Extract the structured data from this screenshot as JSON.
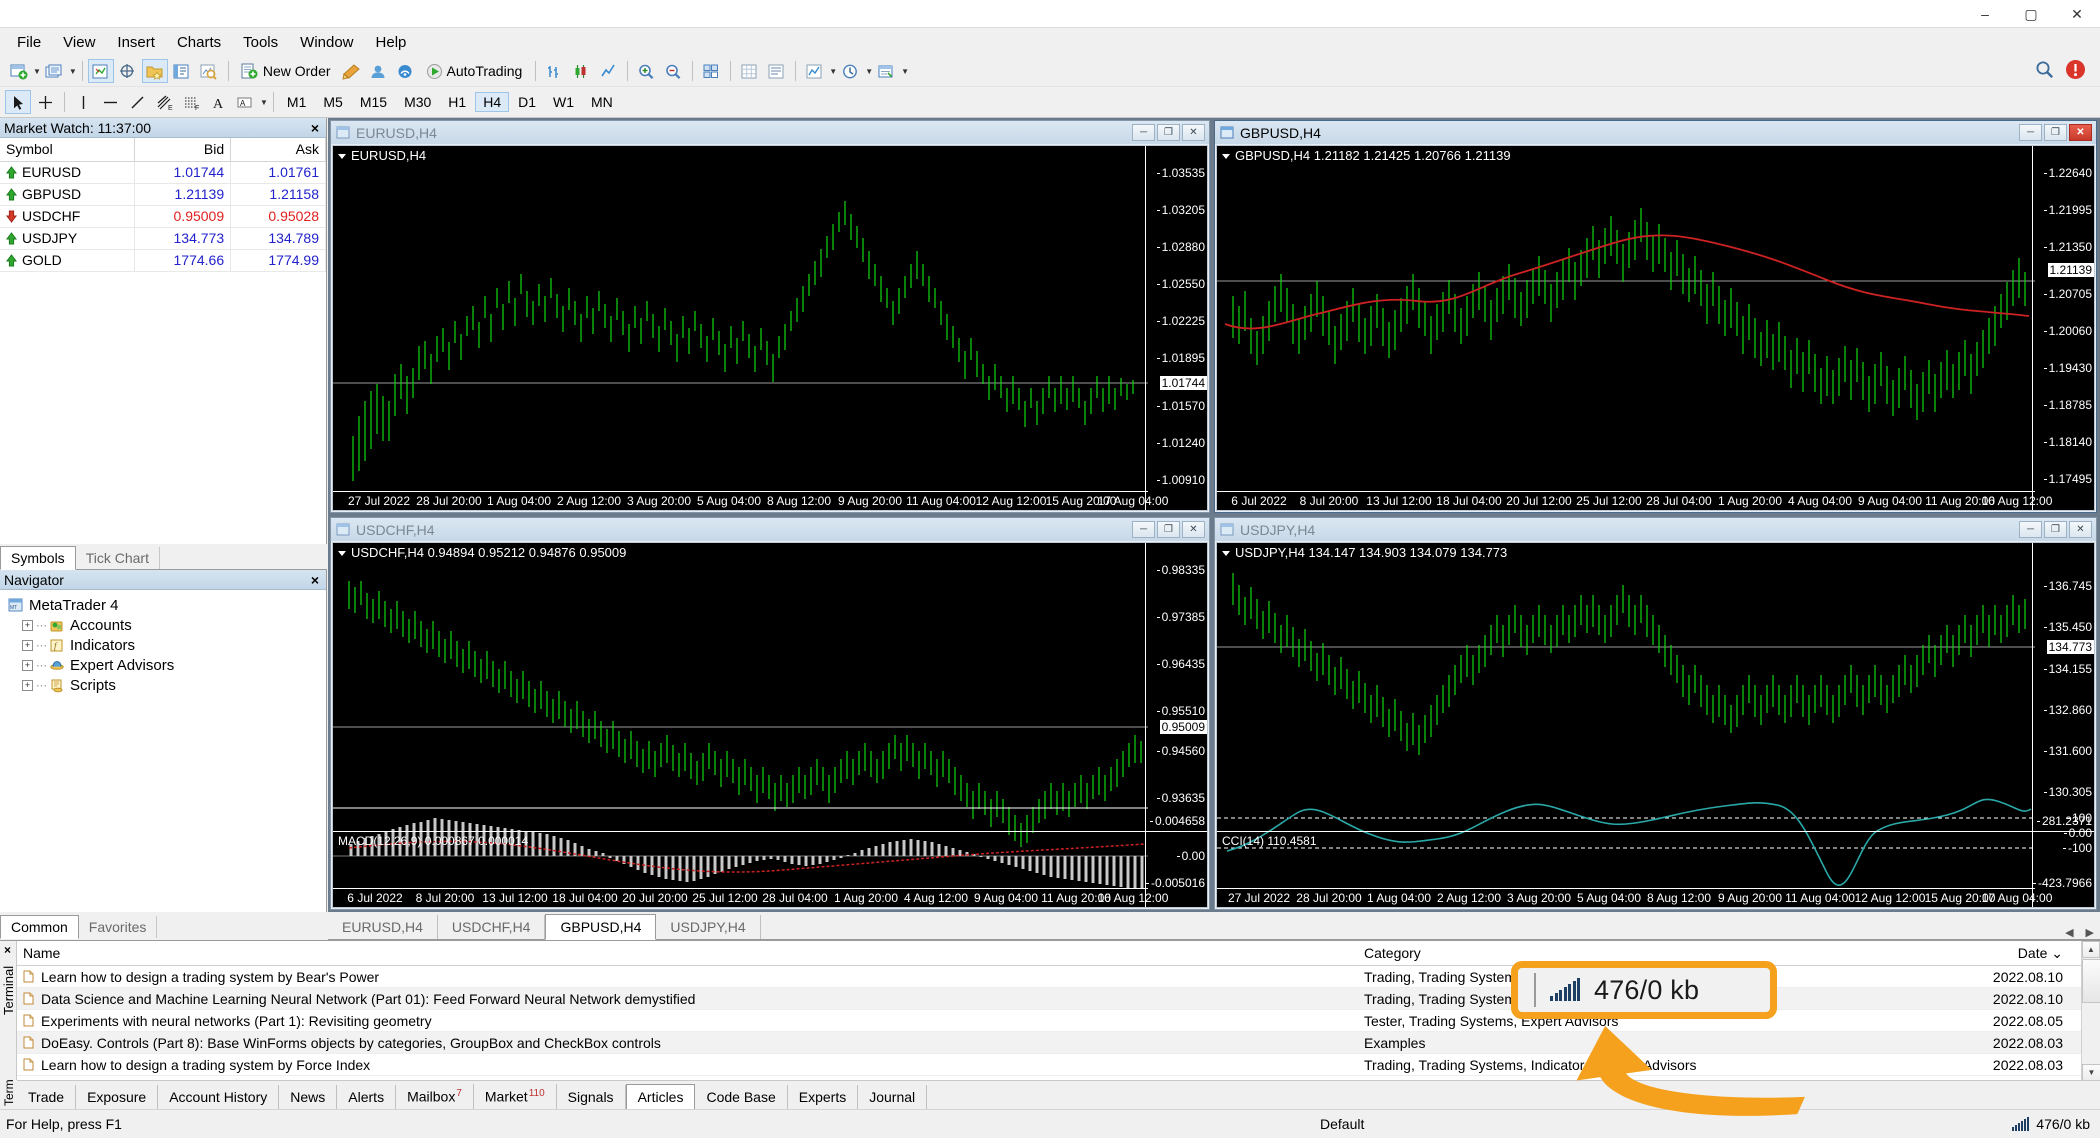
{
  "window": {
    "minimize": "–",
    "maximize": "▢",
    "close": "✕"
  },
  "menu": [
    "File",
    "View",
    "Insert",
    "Charts",
    "Tools",
    "Window",
    "Help"
  ],
  "toolbar": {
    "new_order_label": "New Order",
    "autotrading_label": "AutoTrading",
    "timeframes": [
      "M1",
      "M5",
      "M15",
      "M30",
      "H1",
      "H4",
      "D1",
      "W1",
      "MN"
    ],
    "timeframe_selected": "H4"
  },
  "market_watch": {
    "title": "Market Watch: 11:37:00",
    "close": "×",
    "columns": [
      "Symbol",
      "Bid",
      "Ask"
    ],
    "rows": [
      {
        "symbol": "EURUSD",
        "bid": "1.01744",
        "ask": "1.01761",
        "dir": "up"
      },
      {
        "symbol": "GBPUSD",
        "bid": "1.21139",
        "ask": "1.21158",
        "dir": "up"
      },
      {
        "symbol": "USDCHF",
        "bid": "0.95009",
        "ask": "0.95028",
        "dir": "down"
      },
      {
        "symbol": "USDJPY",
        "bid": "134.773",
        "ask": "134.789",
        "dir": "up"
      },
      {
        "symbol": "GOLD",
        "bid": "1774.66",
        "ask": "1774.99",
        "dir": "up"
      }
    ],
    "tabs": [
      "Symbols",
      "Tick Chart"
    ],
    "tab_selected": "Symbols"
  },
  "navigator": {
    "title": "Navigator",
    "close": "×",
    "root": "MetaTrader 4",
    "items": [
      "Accounts",
      "Indicators",
      "Expert Advisors",
      "Scripts"
    ],
    "tabs": [
      "Common",
      "Favorites"
    ],
    "tab_selected": "Common"
  },
  "charts": [
    {
      "title": "EURUSD,H4",
      "label": "EURUSD,H4",
      "active": false,
      "price_ticks": [
        "1.03535",
        "1.03205",
        "1.02880",
        "1.02550",
        "1.02225",
        "1.01895",
        "1.01570",
        "1.01240",
        "1.00910"
      ],
      "current_price": "1.01744",
      "time_ticks": [
        "27 Jul 2022",
        "28 Jul 20:00",
        "1 Aug 04:00",
        "2 Aug 12:00",
        "3 Aug 20:00",
        "5 Aug 04:00",
        "8 Aug 12:00",
        "9 Aug 20:00",
        "11 Aug 04:00",
        "12 Aug 12:00",
        "15 Aug 20:00",
        "17 Aug 04:00"
      ]
    },
    {
      "title": "GBPUSD,H4",
      "label": "GBPUSD,H4  1.21182 1.21425 1.20766 1.21139",
      "active": true,
      "price_ticks": [
        "1.22640",
        "1.21995",
        "1.21350",
        "1.20705",
        "1.20060",
        "1.19430",
        "1.18785",
        "1.18140",
        "1.17495"
      ],
      "current_price": "1.21139",
      "time_ticks": [
        "6 Jul 2022",
        "8 Jul 20:00",
        "13 Jul 12:00",
        "18 Jul 04:00",
        "20 Jul 12:00",
        "25 Jul 12:00",
        "28 Jul 04:00",
        "1 Aug 20:00",
        "4 Aug 04:00",
        "9 Aug 04:00",
        "11 Aug 20:00",
        "16 Aug 12:00"
      ]
    },
    {
      "title": "USDCHF,H4",
      "label": "USDCHF,H4  0.94894 0.95212 0.94876 0.95009",
      "active": false,
      "price_ticks": [
        "0.98335",
        "0.97385",
        "0.96435",
        "0.95510",
        "0.94560",
        "0.93635"
      ],
      "current_price": "0.95009",
      "indicator": {
        "name": "MACD(12,26,9) 0.000867 0.000014",
        "ticks": [
          "0.004658",
          "0.00",
          "-0.005016"
        ]
      },
      "time_ticks": [
        "6 Jul 2022",
        "8 Jul 20:00",
        "13 Jul 12:00",
        "18 Jul 04:00",
        "20 Jul 20:00",
        "25 Jul 12:00",
        "28 Jul 04:00",
        "1 Aug 20:00",
        "4 Aug 12:00",
        "9 Aug 04:00",
        "11 Aug 20:00",
        "16 Aug 12:00"
      ]
    },
    {
      "title": "USDJPY,H4",
      "label": "USDJPY,H4  134.147 134.903 134.079 134.773",
      "active": false,
      "price_ticks": [
        "136.745",
        "135.450",
        "134.155",
        "132.860",
        "131.600",
        "130.305"
      ],
      "current_price": "134.773",
      "indicator": {
        "name": "CCI(14) 110.4581",
        "ticks": [
          "281.2371",
          "100",
          "0.00",
          "-100",
          "-423.7966"
        ]
      },
      "time_ticks": [
        "27 Jul 2022",
        "28 Jul 20:00",
        "1 Aug 04:00",
        "2 Aug 12:00",
        "3 Aug 20:00",
        "5 Aug 04:00",
        "8 Aug 12:00",
        "9 Aug 20:00",
        "11 Aug 04:00",
        "12 Aug 12:00",
        "15 Aug 20:00",
        "17 Aug 04:00"
      ]
    }
  ],
  "chart_tabs": {
    "items": [
      "EURUSD,H4",
      "USDCHF,H4",
      "GBPUSD,H4",
      "USDJPY,H4"
    ],
    "selected": "GBPUSD,H4"
  },
  "terminal": {
    "vertical_label": "Terminal",
    "close": "×",
    "columns": [
      "Name",
      "Category",
      "Date"
    ],
    "sort_glyph": "⌄",
    "rows": [
      {
        "name": "Learn how to design a trading system by Bear's Power",
        "category": "Trading, Trading Systems,",
        "date": "2022.08.10"
      },
      {
        "name": "Data Science and Machine Learning  Neural Network (Part 01): Feed Forward Neural Network demystified",
        "category": "Trading, Trading Systems,",
        "date": "2022.08.10"
      },
      {
        "name": "Experiments with neural networks (Part 1): Revisiting geometry",
        "category": "Tester, Trading Systems, Expert Advisors",
        "date": "2022.08.05"
      },
      {
        "name": "DoEasy. Controls (Part 8): Base WinForms objects by categories, GroupBox and CheckBox controls",
        "category": "Examples",
        "date": "2022.08.03"
      },
      {
        "name": "Learn how to design a trading system by Force Index",
        "category": "Trading, Trading Systems, Indicators, Expert Advisors",
        "date": "2022.08.03"
      }
    ]
  },
  "bottom_tabs": {
    "vertical_label": "Term",
    "items": [
      {
        "label": "Trade",
        "badge": ""
      },
      {
        "label": "Exposure",
        "badge": ""
      },
      {
        "label": "Account History",
        "badge": ""
      },
      {
        "label": "News",
        "badge": ""
      },
      {
        "label": "Alerts",
        "badge": ""
      },
      {
        "label": "Mailbox",
        "badge": "7"
      },
      {
        "label": "Market",
        "badge": "110"
      },
      {
        "label": "Signals",
        "badge": ""
      },
      {
        "label": "Articles",
        "badge": ""
      },
      {
        "label": "Code Base",
        "badge": ""
      },
      {
        "label": "Experts",
        "badge": ""
      },
      {
        "label": "Journal",
        "badge": ""
      }
    ],
    "selected": "Articles"
  },
  "status_bar": {
    "help": "For Help, press F1",
    "profile": "Default",
    "connection": "476/0 kb"
  },
  "callout": {
    "value": "476/0 kb"
  },
  "colors": {
    "accent_orange": "#f5a11e",
    "bull_green": "#12d912",
    "bid_blue": "#2222cc",
    "bid_red": "#e02020",
    "ma_red": "#cc2222",
    "cci_cyan": "#2aa8a8",
    "chart_bg": "#000000"
  }
}
